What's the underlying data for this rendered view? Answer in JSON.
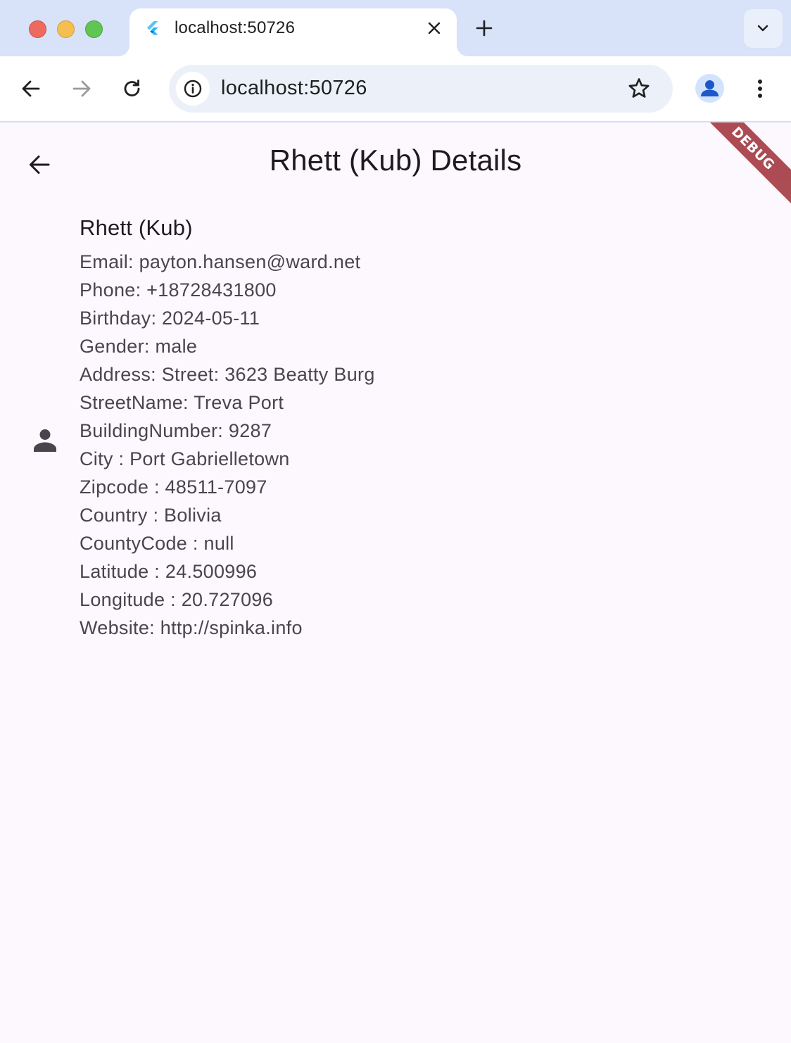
{
  "browser": {
    "tab_title": "localhost:50726",
    "url": "localhost:50726",
    "icons": {
      "favicon": "flutter-icon",
      "close": "close-icon",
      "new_tab": "plus-icon",
      "tab_search": "chevron-down-icon",
      "back": "arrow-left-icon",
      "forward": "arrow-right-icon",
      "reload": "reload-icon",
      "site_info": "info-icon",
      "bookmark": "star-icon",
      "profile": "person-icon",
      "menu": "kebab-icon"
    }
  },
  "app": {
    "title": "Rhett (Kub) Details",
    "debug_banner": "DEBUG",
    "contact": {
      "name": "Rhett (Kub)",
      "lines": [
        "Email: payton.hansen@ward.net",
        "Phone: +18728431800",
        "Birthday: 2024-05-11",
        "Gender: male",
        "Address: Street: 3623 Beatty Burg",
        "StreetName: Treva Port",
        "BuildingNumber: 9287",
        "City : Port Gabrielletown",
        "Zipcode : 48511-7097",
        "Country : Bolivia",
        "CountyCode : null",
        "Latitude : 24.500996",
        "Longitude : 20.727096",
        "Website: http://spinka.info"
      ]
    },
    "colors": {
      "background": "#fdf7fe",
      "title_text": "#1d1b20",
      "body_text": "#49454f",
      "debug_banner": "#a8424a"
    }
  }
}
